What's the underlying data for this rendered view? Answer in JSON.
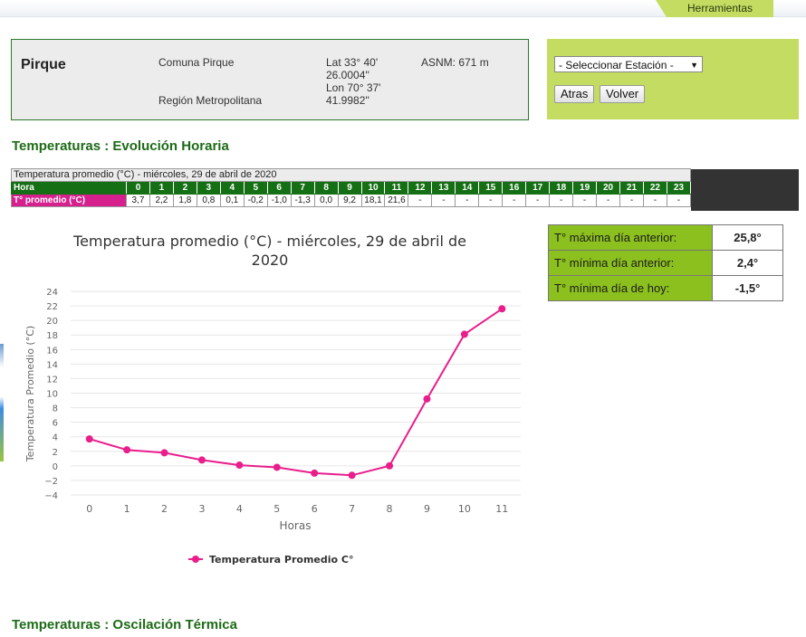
{
  "header": {
    "tools_label": "Herramientas"
  },
  "station": {
    "name": "Pirque",
    "comuna": "Comuna Pirque",
    "region": "Región Metropolitana",
    "lat": "Lat 33° 40' 26.0004''",
    "lon": "Lon 70° 37' 41.9982''",
    "asnm": "ASNM: 671 m"
  },
  "controls": {
    "select_value": "- Seleccionar Estación -",
    "atras_label": "Atras",
    "volver_label": "Volver"
  },
  "sections": {
    "hourly_title": "Temperaturas : Evolución Horaria",
    "oscillation_title": "Temperaturas : Oscilación Térmica"
  },
  "hourly_table": {
    "caption": "Temperatura promedio (°C) - miércoles, 29 de abril de 2020",
    "hour_label": "Hora",
    "value_label": "T° promedio (°C)",
    "hours": [
      "0",
      "1",
      "2",
      "3",
      "4",
      "5",
      "6",
      "7",
      "8",
      "9",
      "10",
      "11",
      "12",
      "13",
      "14",
      "15",
      "16",
      "17",
      "18",
      "19",
      "20",
      "21",
      "22",
      "23"
    ],
    "values": [
      "3,7",
      "2,2",
      "1,8",
      "0,8",
      "0,1",
      "-0,2",
      "-1,0",
      "-1,3",
      "0,0",
      "9,2",
      "18,1",
      "21,6",
      "-",
      "-",
      "-",
      "-",
      "-",
      "-",
      "-",
      "-",
      "-",
      "-",
      "-",
      "-"
    ]
  },
  "stats": [
    {
      "label": "T° máxima día anterior:",
      "value": "25,8°"
    },
    {
      "label": "T° mínima día anterior:",
      "value": "2,4°"
    },
    {
      "label": "T° mínima día de hoy:",
      "value": "-1,5°"
    }
  ],
  "chart_data": {
    "type": "line",
    "title": "Temperatura promedio (°C) - miércoles, 29 de abril de 2020",
    "xlabel": "Horas",
    "ylabel": "Temperatura Promedio (°C)",
    "x": [
      0,
      1,
      2,
      3,
      4,
      5,
      6,
      7,
      8,
      9,
      10,
      11
    ],
    "series": [
      {
        "name": "Temperatura Promedio C°",
        "values": [
          3.7,
          2.2,
          1.8,
          0.8,
          0.1,
          -0.2,
          -1.0,
          -1.3,
          0.0,
          9.2,
          18.1,
          21.6
        ]
      }
    ],
    "ylim": [
      -4,
      24
    ],
    "yticks": [
      -4,
      -2,
      0,
      2,
      4,
      6,
      8,
      10,
      12,
      14,
      16,
      18,
      20,
      22,
      24
    ],
    "grid": true,
    "legend_position": "bottom",
    "series_color": "#e91e8c"
  }
}
